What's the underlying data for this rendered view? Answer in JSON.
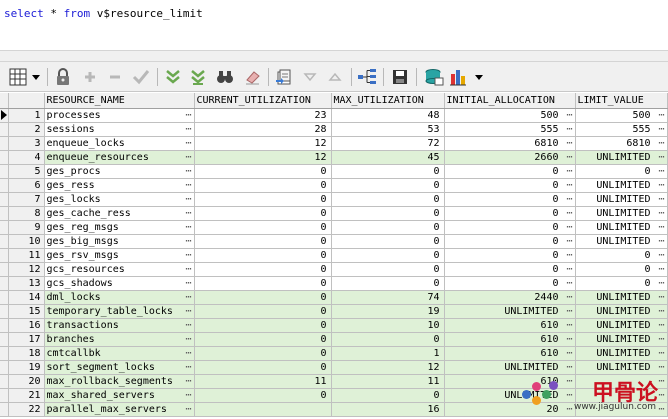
{
  "editor": {
    "sql_select": "select",
    "sql_rest": " * ",
    "sql_from": "from",
    "sql_table": " v$resource_limit"
  },
  "toolbar": {
    "icons": [
      "grid-icon",
      "lock-icon",
      "add-row-icon",
      "delete-row-icon",
      "post-icon",
      "filter-icon",
      "clear-filter-icon",
      "find-icon",
      "eraser-icon",
      "export-icon",
      "sort-asc-icon",
      "sort-desc-icon",
      "tree-icon",
      "save-icon",
      "query-icon",
      "chart-icon"
    ]
  },
  "grid": {
    "columns": [
      "RESOURCE_NAME",
      "CURRENT_UTILIZATION",
      "MAX_UTILIZATION",
      "INITIAL_ALLOCATION",
      "LIMIT_VALUE"
    ],
    "rows": [
      {
        "n": "1",
        "name": "processes",
        "cur": "23",
        "max": "48",
        "init": "500",
        "limit": "500"
      },
      {
        "n": "2",
        "name": "sessions",
        "cur": "28",
        "max": "53",
        "init": "555",
        "limit": "555"
      },
      {
        "n": "3",
        "name": "enqueue_locks",
        "cur": "12",
        "max": "72",
        "init": "6810",
        "limit": "6810"
      },
      {
        "n": "4",
        "name": "enqueue_resources",
        "cur": "12",
        "max": "45",
        "init": "2660",
        "limit": "UNLIMITED"
      },
      {
        "n": "5",
        "name": "ges_procs",
        "cur": "0",
        "max": "0",
        "init": "0",
        "limit": "0"
      },
      {
        "n": "6",
        "name": "ges_ress",
        "cur": "0",
        "max": "0",
        "init": "0",
        "limit": "UNLIMITED"
      },
      {
        "n": "7",
        "name": "ges_locks",
        "cur": "0",
        "max": "0",
        "init": "0",
        "limit": "UNLIMITED"
      },
      {
        "n": "8",
        "name": "ges_cache_ress",
        "cur": "0",
        "max": "0",
        "init": "0",
        "limit": "UNLIMITED"
      },
      {
        "n": "9",
        "name": "ges_reg_msgs",
        "cur": "0",
        "max": "0",
        "init": "0",
        "limit": "UNLIMITED"
      },
      {
        "n": "10",
        "name": "ges_big_msgs",
        "cur": "0",
        "max": "0",
        "init": "0",
        "limit": "UNLIMITED"
      },
      {
        "n": "11",
        "name": "ges_rsv_msgs",
        "cur": "0",
        "max": "0",
        "init": "0",
        "limit": "0"
      },
      {
        "n": "12",
        "name": "gcs_resources",
        "cur": "0",
        "max": "0",
        "init": "0",
        "limit": "0"
      },
      {
        "n": "13",
        "name": "gcs_shadows",
        "cur": "0",
        "max": "0",
        "init": "0",
        "limit": "0"
      },
      {
        "n": "14",
        "name": "dml_locks",
        "cur": "0",
        "max": "74",
        "init": "2440",
        "limit": "UNLIMITED"
      },
      {
        "n": "15",
        "name": "temporary_table_locks",
        "cur": "0",
        "max": "19",
        "init": "UNLIMITED",
        "limit": "UNLIMITED"
      },
      {
        "n": "16",
        "name": "transactions",
        "cur": "0",
        "max": "10",
        "init": "610",
        "limit": "UNLIMITED"
      },
      {
        "n": "17",
        "name": "branches",
        "cur": "0",
        "max": "0",
        "init": "610",
        "limit": "UNLIMITED"
      },
      {
        "n": "18",
        "name": "cmtcallbk",
        "cur": "0",
        "max": "1",
        "init": "610",
        "limit": "UNLIMITED"
      },
      {
        "n": "19",
        "name": "sort_segment_locks",
        "cur": "0",
        "max": "12",
        "init": "UNLIMITED",
        "limit": "UNLIMITED"
      },
      {
        "n": "20",
        "name": "max_rollback_segments",
        "cur": "11",
        "max": "11",
        "init": "610",
        "limit": ""
      },
      {
        "n": "21",
        "name": "max_shared_servers",
        "cur": "0",
        "max": "0",
        "init": "UNLIMITED",
        "limit": ""
      },
      {
        "n": "22",
        "name": "parallel_max_servers",
        "cur": "",
        "max": "16",
        "init": "20",
        "limit": ""
      }
    ]
  },
  "watermark": {
    "logo": "甲骨论",
    "url": "www.jiagulun.com"
  },
  "colors": {
    "green_row": "#dff1d7",
    "keyword": "#1a1ad6",
    "watermark_red": "#cc1020"
  }
}
